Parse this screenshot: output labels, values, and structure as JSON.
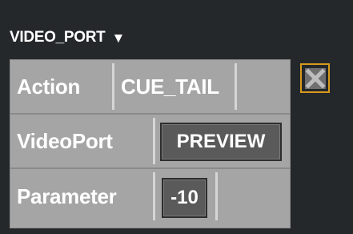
{
  "header": {
    "title": "VIDEO_PORT",
    "caret": "▼"
  },
  "rows": [
    {
      "label": "Action",
      "value": "CUE_TAIL"
    },
    {
      "label": "VideoPort",
      "value": "PREVIEW"
    },
    {
      "label": "Parameter",
      "value": "-10"
    }
  ],
  "icons": {
    "close": "close-icon"
  },
  "colors": {
    "background": "#25282b",
    "panel": "#a5a5a5",
    "value_box": "#5a5a5a",
    "close_border": "#d89a1c"
  }
}
